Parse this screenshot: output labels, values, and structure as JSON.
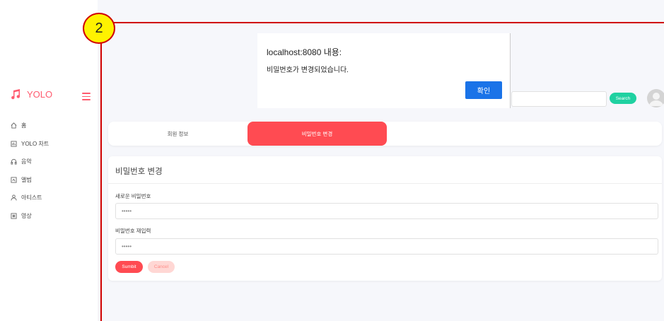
{
  "brand": {
    "name": "YOLO"
  },
  "sidebar": {
    "items": [
      {
        "label": "홈",
        "icon": "home-icon"
      },
      {
        "label": "YOLO 차트",
        "icon": "chart-icon"
      },
      {
        "label": "음악",
        "icon": "headphones-icon"
      },
      {
        "label": "앨범",
        "icon": "album-icon"
      },
      {
        "label": "아티스트",
        "icon": "user-icon"
      },
      {
        "label": "영상",
        "icon": "video-icon"
      }
    ]
  },
  "header": {
    "search_label": "Search",
    "search_value": ""
  },
  "tabs": [
    {
      "label": "회원 정보",
      "active": false
    },
    {
      "label": "비밀번호 변경",
      "active": true
    }
  ],
  "form": {
    "title": "비밀번호 변경",
    "new_password_label": "새로운 비밀번호",
    "new_password_value": "•••••",
    "confirm_label": "비밀번호 재입력",
    "confirm_value": "•••••",
    "submit_label": "Sumbit",
    "cancel_label": "Cancel"
  },
  "dialog": {
    "title": "localhost:8080 내용:",
    "message": "비밀번호가 변경되었습니다.",
    "ok_label": "확인"
  },
  "annotation": {
    "badge": "2"
  },
  "colors": {
    "accent": "#ff4b52",
    "brand": "#ff5a6e",
    "search_button": "#1fd1a1",
    "dialog_button": "#1a73e8",
    "annotation_line": "#d00000",
    "annotation_badge": "#fff200"
  }
}
